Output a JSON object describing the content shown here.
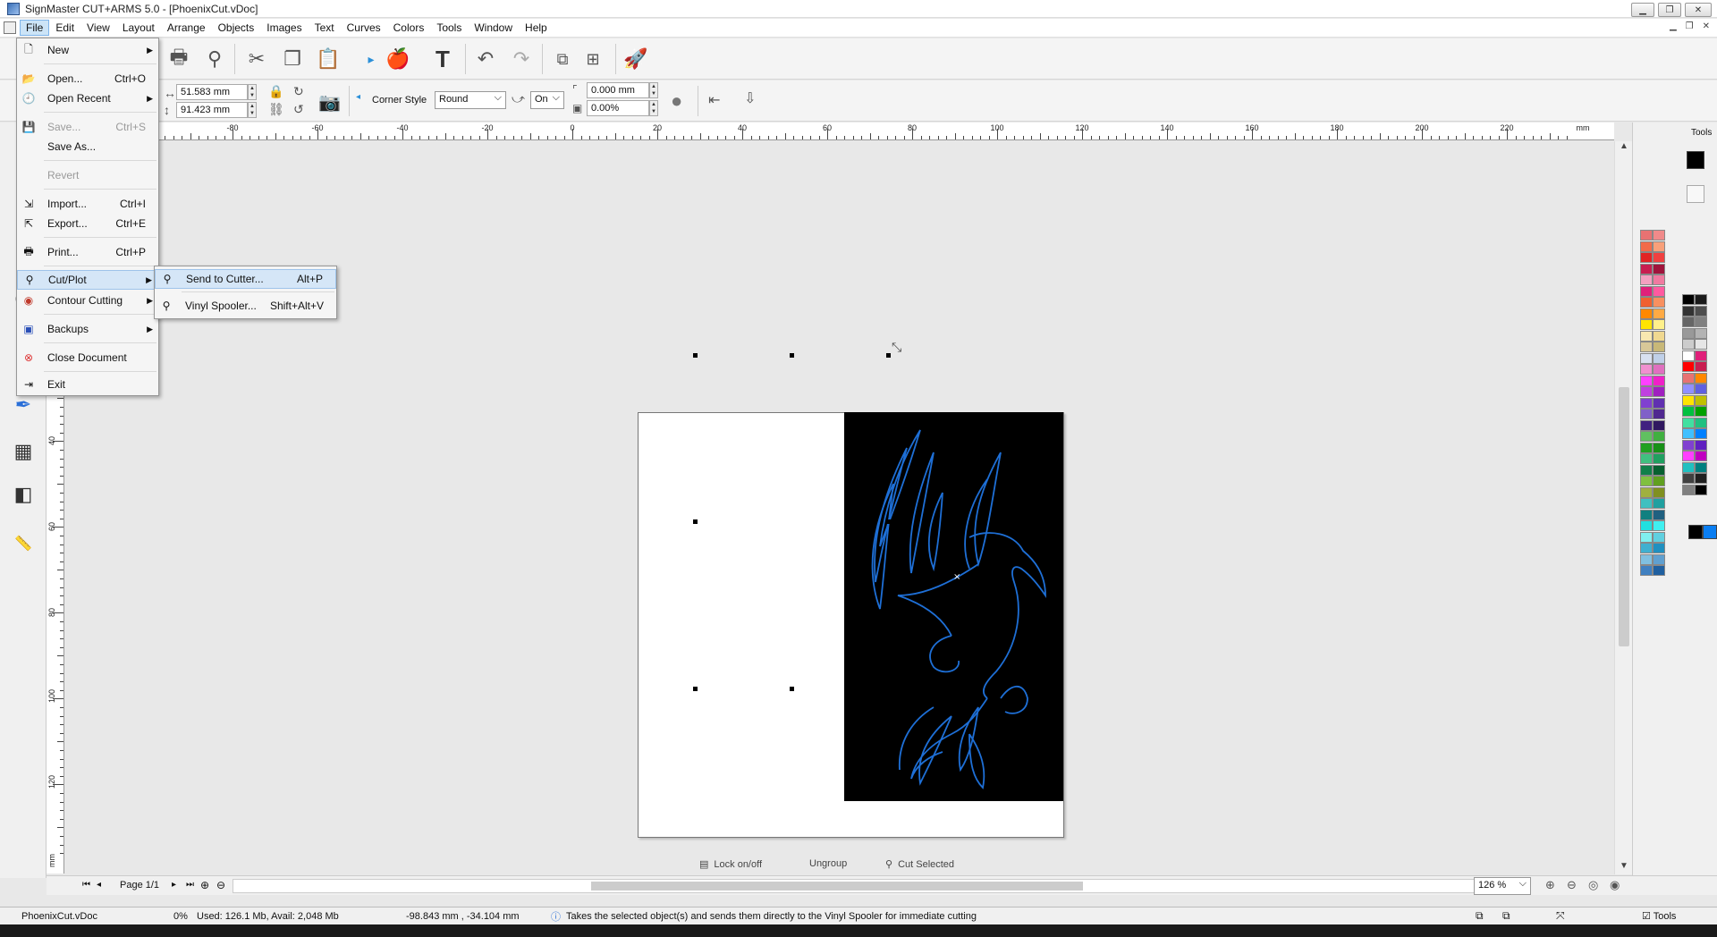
{
  "window": {
    "title": "SignMaster CUT+ARMS 5.0 - [PhoenixCut.vDoc]"
  },
  "menubar": {
    "items": [
      "File",
      "Edit",
      "View",
      "Layout",
      "Arrange",
      "Objects",
      "Images",
      "Text",
      "Curves",
      "Colors",
      "Tools",
      "Window",
      "Help"
    ]
  },
  "file_menu": {
    "new": "New",
    "open": "Open...",
    "open_short": "Ctrl+O",
    "open_recent": "Open Recent",
    "save": "Save...",
    "save_short": "Ctrl+S",
    "save_as": "Save As...",
    "revert": "Revert",
    "import": "Import...",
    "import_short": "Ctrl+I",
    "export": "Export...",
    "export_short": "Ctrl+E",
    "print": "Print...",
    "print_short": "Ctrl+P",
    "cut_plot": "Cut/Plot",
    "contour": "Contour Cutting",
    "backups": "Backups",
    "close": "Close Document",
    "exit": "Exit"
  },
  "cutplot_submenu": {
    "send": "Send to Cutter...",
    "send_short": "Alt+P",
    "spooler": "Vinyl Spooler...",
    "spooler_short": "Shift+Alt+V"
  },
  "propbar": {
    "width": "51.583 mm",
    "height": "91.423 mm",
    "corner_style_label": "Corner Style",
    "corner_style": "Round",
    "corner_on": "On",
    "corner_radius": "0.000 mm",
    "corner_pct": "0.00%"
  },
  "hruler": {
    "labels": [
      "-80",
      "-60",
      "-40",
      "-20",
      "0",
      "20",
      "40",
      "60",
      "80",
      "100",
      "120",
      "140",
      "160",
      "180",
      "200",
      "220",
      "mm"
    ]
  },
  "vruler": {
    "labels": [
      "40",
      "60",
      "80",
      "100",
      "120",
      "mm"
    ]
  },
  "bottom_actions": {
    "lock": "Lock on/off",
    "ungroup": "Ungroup",
    "cut_selected": "Cut Selected"
  },
  "pagebar": {
    "page": "Page 1/1",
    "zoom": "126 %"
  },
  "statusbar": {
    "doc": "PhoenixCut.vDoc",
    "progress": "0%",
    "memory": "Used: 126.1 Mb, Avail: 2,048 Mb",
    "coords": "-98.843 mm , -34.104 mm",
    "hint": "Takes the selected object(s) and sends them directly to the Vinyl Spooler for immediate cutting",
    "tools": "Tools"
  },
  "panel": {
    "tools_label": "Tools"
  },
  "colors": {
    "accent": "#cce4f7",
    "phoenix": "#1e6fd6"
  }
}
